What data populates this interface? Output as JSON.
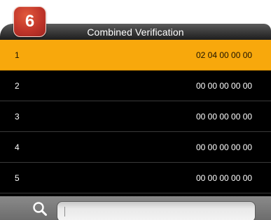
{
  "badge": {
    "step": "6",
    "color": "#c0352a"
  },
  "header": {
    "title": "Combined Verification"
  },
  "list": {
    "items": [
      {
        "index": "1",
        "value": "02 04 00 00 00",
        "selected": true
      },
      {
        "index": "2",
        "value": "00 00 00 00 00",
        "selected": false
      },
      {
        "index": "3",
        "value": "00 00 00 00 00",
        "selected": false
      },
      {
        "index": "4",
        "value": "00 00 00 00 00",
        "selected": false
      },
      {
        "index": "5",
        "value": "00 00 00 00 00",
        "selected": false
      }
    ],
    "selected_color": "#f8a80c"
  },
  "search": {
    "value": "",
    "icon": "magnifier-icon"
  }
}
